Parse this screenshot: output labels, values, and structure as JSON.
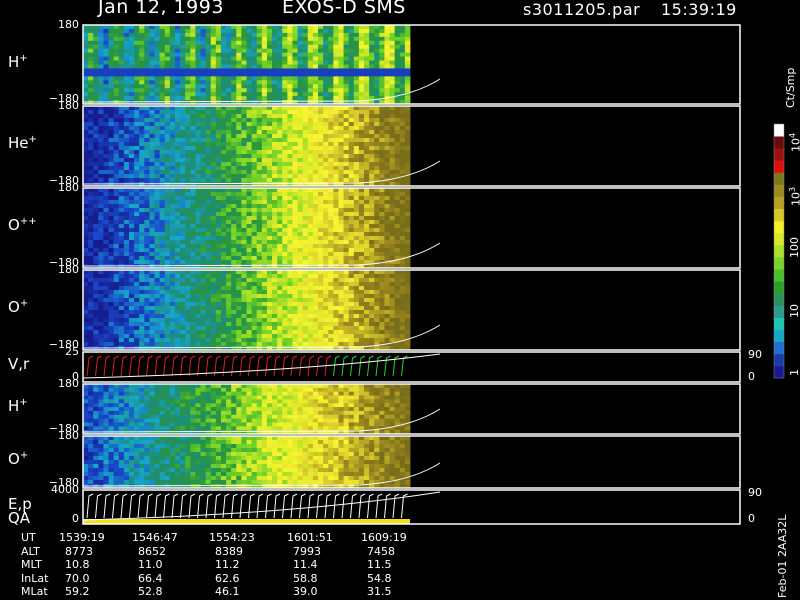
{
  "header": {
    "date": "Jan 12, 1993",
    "instrument": "EXOS-D SMS",
    "file": "s3011205.par",
    "time": "15:39:19"
  },
  "chart_data": {
    "type": "heatmap",
    "panels": [
      {
        "id": "h1",
        "label": "H",
        "sup": "+",
        "ytop": "180",
        "ybot": "−180",
        "right_top": "",
        "right_bot": ""
      },
      {
        "id": "he",
        "label": "He",
        "sup": "+",
        "ytop": "180",
        "ybot": "−180",
        "right_top": "",
        "right_bot": ""
      },
      {
        "id": "opp",
        "label": "O",
        "sup": "++",
        "ytop": "180",
        "ybot": "−180",
        "right_top": "",
        "right_bot": ""
      },
      {
        "id": "o1",
        "label": "O",
        "sup": "+",
        "ytop": "180",
        "ybot": "−180",
        "right_top": "",
        "right_bot": ""
      },
      {
        "id": "vr",
        "label": "V,r",
        "sup": "",
        "ytop": "25",
        "ybot": "0",
        "right_top": "90",
        "right_bot": "0"
      },
      {
        "id": "h2",
        "label": "H",
        "sup": "+",
        "ytop": "180",
        "ybot": "−180",
        "right_top": "",
        "right_bot": ""
      },
      {
        "id": "o2",
        "label": "O",
        "sup": "+",
        "ytop": "180",
        "ybot": "−180",
        "right_top": "",
        "right_bot": ""
      },
      {
        "id": "ep",
        "label": "E,p",
        "sup": "",
        "label2": "QA",
        "ytop": "4000",
        "ybot": "0",
        "right_top": "90",
        "right_bot": "0"
      }
    ],
    "colorbar": {
      "title": "Ct/Smp",
      "ticks": [
        {
          "label": "10",
          "sup": "4"
        },
        {
          "label": "10",
          "sup": "3"
        },
        {
          "label": "100",
          "sup": ""
        },
        {
          "label": "10",
          "sup": ""
        },
        {
          "label": "1",
          "sup": ""
        }
      ],
      "colors": [
        "#1a1a8c",
        "#1e3aa8",
        "#1e6fd0",
        "#17a8c8",
        "#1cc6b0",
        "#2e9a8c",
        "#2f8f5a",
        "#2a9d2a",
        "#4cbf2a",
        "#7ad32a",
        "#a8e02a",
        "#d8e82a",
        "#f4f02a",
        "#d8c828",
        "#b8a020",
        "#9a8a20",
        "#7a7a1a",
        "#e01010",
        "#a01010",
        "#6a0a0a",
        "#ffffff"
      ]
    },
    "time_axis": {
      "rows": [
        {
          "name": "UT",
          "values": [
            "1539:19",
            "1546:47",
            "1554:23",
            "1601:51",
            "1609:19"
          ]
        },
        {
          "name": "ALT",
          "values": [
            "8773",
            "8652",
            "8389",
            "7993",
            "7458"
          ]
        },
        {
          "name": "MLT",
          "values": [
            "10.8",
            "11.0",
            "11.2",
            "11.4",
            "11.5"
          ]
        },
        {
          "name": "InLat",
          "values": [
            "70.0",
            "66.4",
            "62.6",
            "58.8",
            "54.8"
          ]
        },
        {
          "name": "MLat",
          "values": [
            "59.2",
            "52.8",
            "46.1",
            "39.0",
            "31.5"
          ]
        }
      ]
    },
    "footer_note": "Feb-01 2AA32L"
  }
}
